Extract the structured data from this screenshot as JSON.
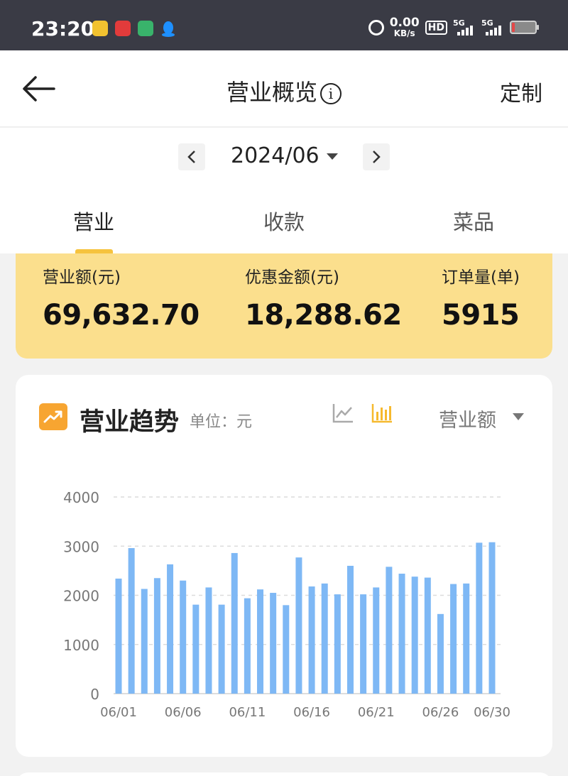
{
  "status_bar": {
    "time": "23:20",
    "net_speed": "0.00",
    "net_unit": "KB/s",
    "hd_label": "HD",
    "signal_1": "5G",
    "signal_2": "5G",
    "app_colors": [
      "#f2c230",
      "#e23b3b",
      "#39b36b",
      "#1e90ff"
    ]
  },
  "header": {
    "title": "营业概览",
    "info_glyph": "i",
    "customize_label": "定制"
  },
  "date_nav": {
    "current": "2024/06"
  },
  "tabs": [
    {
      "label": "营业",
      "active": true
    },
    {
      "label": "收款",
      "active": false
    },
    {
      "label": "菜品",
      "active": false
    }
  ],
  "summary": {
    "revenue_label": "营业额(元)",
    "revenue_value": "69,632.70",
    "discount_label": "优惠金额(元)",
    "discount_value": "18,288.62",
    "orders_label": "订单量(单)",
    "orders_value": "5915"
  },
  "trend_card": {
    "title": "营业趋势",
    "unit_label": "单位：元",
    "selected_metric": "营业额",
    "accent_color": "#f6c33e",
    "bar_color": "#7eb8f5"
  },
  "chart_data": {
    "type": "bar",
    "categories": [
      "06/01",
      "06/02",
      "06/03",
      "06/04",
      "06/05",
      "06/06",
      "06/07",
      "06/08",
      "06/09",
      "06/10",
      "06/11",
      "06/12",
      "06/13",
      "06/14",
      "06/15",
      "06/16",
      "06/17",
      "06/18",
      "06/19",
      "06/20",
      "06/21",
      "06/22",
      "06/23",
      "06/24",
      "06/25",
      "06/26",
      "06/27",
      "06/28",
      "06/29",
      "06/30"
    ],
    "values": [
      2340,
      2960,
      2130,
      2350,
      2630,
      2300,
      1810,
      2160,
      1810,
      2860,
      1940,
      2120,
      2050,
      1800,
      2770,
      2180,
      2240,
      2020,
      2600,
      2020,
      2160,
      2580,
      2440,
      2380,
      2360,
      1620,
      2230,
      2240,
      3070,
      3080
    ],
    "x_tick_labels": [
      "06/01",
      "06/06",
      "06/11",
      "06/16",
      "06/21",
      "06/26",
      "06/30"
    ],
    "y_ticks": [
      0,
      1000,
      2000,
      3000,
      4000
    ],
    "ylim": [
      0,
      4000
    ],
    "grid": true
  }
}
